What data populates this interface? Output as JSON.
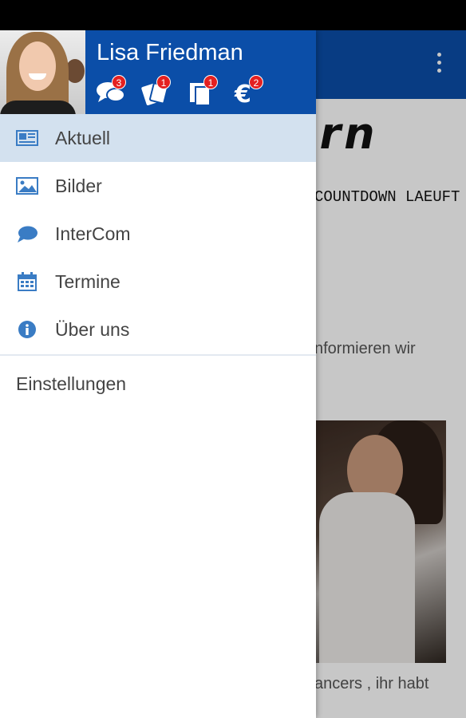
{
  "user": {
    "name": "Lisa Friedman"
  },
  "badges": [
    {
      "icon": "chat-bubbles-icon",
      "count": "3"
    },
    {
      "icon": "tickets-icon",
      "count": "1"
    },
    {
      "icon": "documents-icon",
      "count": "1"
    },
    {
      "icon": "euro-icon",
      "count": "2"
    }
  ],
  "menu": [
    {
      "label": "Aktuell",
      "icon": "news-icon",
      "active": true
    },
    {
      "label": "Bilder",
      "icon": "image-icon",
      "active": false
    },
    {
      "label": "InterCom",
      "icon": "chat-icon",
      "active": false
    },
    {
      "label": "Termine",
      "icon": "calendar-icon",
      "active": false
    },
    {
      "label": "Über uns",
      "icon": "info-icon",
      "active": false
    }
  ],
  "settings_label": "Einstellungen",
  "background": {
    "brand": "tern",
    "countdown": "COUNTDOWN LAEUFT",
    "text1": "nformieren wir",
    "text2": "ancers , ihr habt"
  },
  "colors": {
    "primary": "#0b4ea8",
    "active_row": "#d3e1ef",
    "badge": "#e42020",
    "icon": "#3a7cc4"
  }
}
